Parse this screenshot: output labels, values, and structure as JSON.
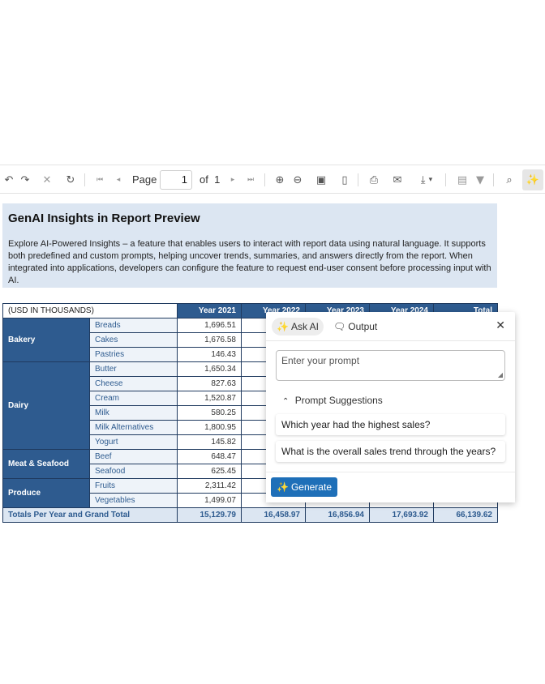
{
  "toolbar": {
    "page_label": "Page",
    "page_value": "1",
    "of_label": "of",
    "page_count": "1",
    "icons": [
      "undo-icon",
      "redo-icon",
      "stop-icon",
      "refresh-icon",
      "first-page-icon",
      "prev-page-icon",
      "next-page-icon",
      "last-page-icon",
      "zoom-in-icon",
      "zoom-out-icon",
      "full-screen-icon",
      "page-icon",
      "print-icon",
      "email-icon",
      "export-icon",
      "parameters-icon",
      "filter-icon",
      "search-icon",
      "ai-sparkle-icon"
    ]
  },
  "report": {
    "title": "GenAI Insights in Report Preview",
    "description": "Explore AI-Powered Insights – a feature that enables users to interact with report data using natural language. It supports both predefined and custom prompts, helping uncover trends, summaries, and answers directly from the report. When integrated into applications, developers can configure the feature to request end-user consent before processing input with AI."
  },
  "table": {
    "unit_label": "(USD IN THOUSANDS)",
    "columns": [
      "Year 2021",
      "Year 2022",
      "Year 2023",
      "Year 2024",
      "Total"
    ],
    "groups": [
      {
        "category": "Bakery",
        "rows": [
          {
            "name": "Breads",
            "y2021": "1,696.51"
          },
          {
            "name": "Cakes",
            "y2021": "1,676.58"
          },
          {
            "name": "Pastries",
            "y2021": "146.43"
          }
        ]
      },
      {
        "category": "Dairy",
        "rows": [
          {
            "name": "Butter",
            "y2021": "1,650.34"
          },
          {
            "name": "Cheese",
            "y2021": "827.63"
          },
          {
            "name": "Cream",
            "y2021": "1,520.87"
          },
          {
            "name": "Milk",
            "y2021": "580.25"
          },
          {
            "name": "Milk Alternatives",
            "y2021": "1,800.95"
          },
          {
            "name": "Yogurt",
            "y2021": "145.82"
          }
        ]
      },
      {
        "category": "Meat & Seafood",
        "rows": [
          {
            "name": "Beef",
            "y2021": "648.47"
          },
          {
            "name": "Seafood",
            "y2021": "625.45"
          }
        ]
      },
      {
        "category": "Produce",
        "rows": [
          {
            "name": "Fruits",
            "y2021": "2,311.42"
          },
          {
            "name": "Vegetables",
            "y2021": "1,499.07"
          }
        ]
      }
    ],
    "totals_label": "Totals Per Year and Grand Total",
    "totals": [
      "15,129.79",
      "16,458.97",
      "16,856.94",
      "17,693.92",
      "66,139.62"
    ]
  },
  "ai_panel": {
    "tab_ask": "Ask AI",
    "tab_output": "Output",
    "prompt_placeholder": "Enter your prompt",
    "suggestions_label": "Prompt Suggestions",
    "suggestions": [
      "Which year had the highest sales?",
      "What is the overall sales trend through the years?"
    ],
    "generate_label": "Generate"
  },
  "colors": {
    "header_blue": "#2e5b8f",
    "light_blue": "#dce6f2",
    "button_blue": "#1e6fb8"
  }
}
